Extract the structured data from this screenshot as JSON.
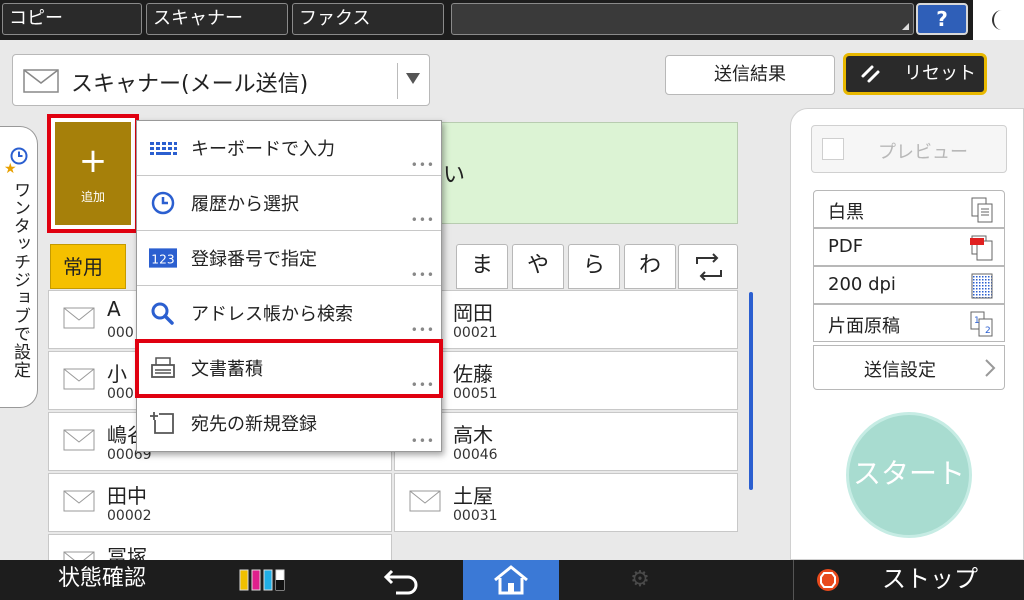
{
  "top_tabs": {
    "copy": "コピー",
    "scanner": "スキャナー",
    "fax": "ファクス"
  },
  "help_label": "?",
  "mode_select": {
    "value": "スキャナー(メール送信)"
  },
  "header_buttons": {
    "send_result": "送信結果",
    "reset": "リセット"
  },
  "side_tab": {
    "label": "ワンタッチジョブで設定"
  },
  "add_button": {
    "plus": "+",
    "label": "追加"
  },
  "destination": {
    "prompt_visible": "い"
  },
  "index_tabs": {
    "frequent": "常用",
    "kana": [
      "ま",
      "や",
      "ら",
      "わ"
    ]
  },
  "add_menu": {
    "items": [
      {
        "label": "キーボードで入力",
        "icon": "keyboard-icon"
      },
      {
        "label": "履歴から選択",
        "icon": "clock-icon"
      },
      {
        "label": "登録番号で指定",
        "icon": "123-icon",
        "icon_text": "123"
      },
      {
        "label": "アドレス帳から検索",
        "icon": "search-icon"
      },
      {
        "label": "文書蓄積",
        "icon": "document-store-icon",
        "highlighted": true
      },
      {
        "label": "宛先の新規登録",
        "icon": "new-entry-icon"
      }
    ],
    "more": "•••"
  },
  "addresses": {
    "left": [
      {
        "name": "A",
        "number": "000"
      },
      {
        "name": "小",
        "number": "000"
      },
      {
        "name": "嶋谷",
        "number": "00069"
      },
      {
        "name": "田中",
        "number": "00002"
      },
      {
        "name": "冨塚",
        "number": ""
      }
    ],
    "right": [
      {
        "name": "岡田",
        "number": "00021"
      },
      {
        "name": "佐藤",
        "number": "00051"
      },
      {
        "name": "高木",
        "number": "00046"
      },
      {
        "name": "土屋",
        "number": "00031"
      }
    ]
  },
  "right_panel": {
    "preview": "プレビュー",
    "settings": [
      {
        "label": "白黒",
        "icon": "color-mode-icon"
      },
      {
        "label": "PDF",
        "icon": "pdf-icon"
      },
      {
        "label": "200 dpi",
        "icon": "resolution-icon"
      },
      {
        "label": "片面原稿",
        "icon": "one-sided-icon"
      }
    ],
    "send_settings": "送信設定",
    "start": "スタート"
  },
  "bottom_bar": {
    "status_check": "状態確認",
    "stop": "ストップ"
  },
  "colors": {
    "accent_blue": "#3b79d6",
    "highlight_red": "#e00010",
    "add_button_gold": "#a6800a",
    "frequent_tab_yellow": "#f5c000",
    "reset_border": "#e8b800",
    "destination_bg": "#dcf3d4",
    "start_button": "#a8dcd0"
  }
}
